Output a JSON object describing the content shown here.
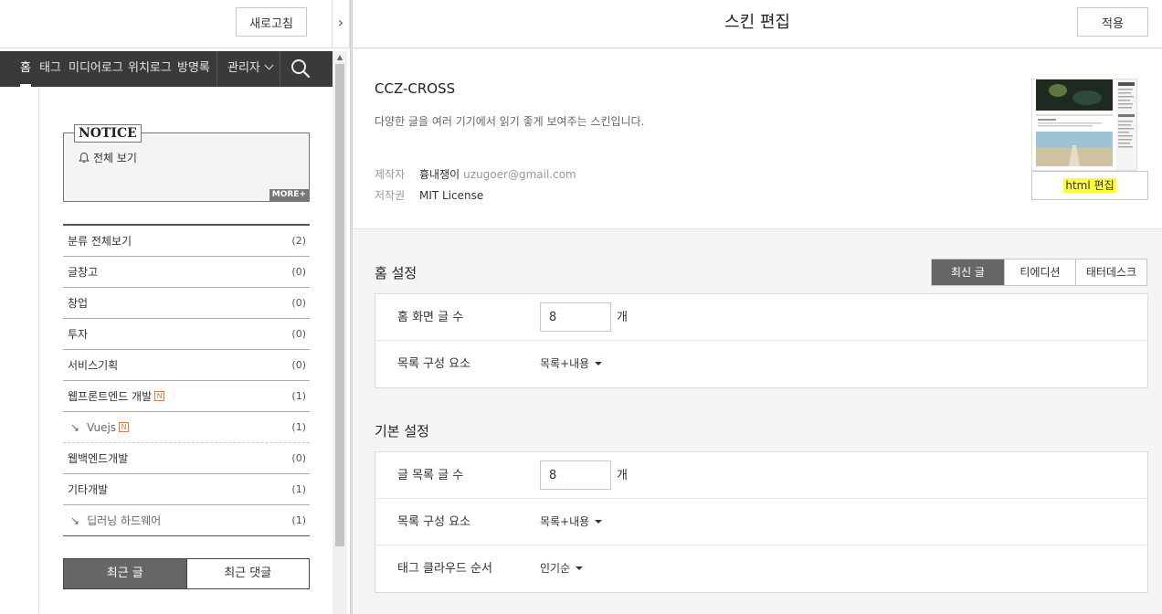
{
  "left": {
    "refresh_label": "새로고침",
    "collapse_glyph": "›",
    "nav": {
      "home": "홈",
      "tag": "태그",
      "media": "미디어로그",
      "location": "위치로그",
      "guestbook": "방명록",
      "admin": "관리자"
    },
    "notice": {
      "title": "NOTICE",
      "view_all": "전체 보기",
      "more": "MORE+"
    },
    "categories": [
      {
        "label": "분류 전체보기",
        "count": "(2)",
        "new": false,
        "sub": false
      },
      {
        "label": "글창고",
        "count": "(0)",
        "new": false,
        "sub": false
      },
      {
        "label": "창업",
        "count": "(0)",
        "new": false,
        "sub": false
      },
      {
        "label": "투자",
        "count": "(0)",
        "new": false,
        "sub": false
      },
      {
        "label": "서비스기획",
        "count": "(0)",
        "new": false,
        "sub": false
      },
      {
        "label": "웹프론트엔드 개발",
        "count": "(1)",
        "new": true,
        "sub": false
      },
      {
        "label": "Vuejs",
        "count": "(1)",
        "new": true,
        "sub": true
      },
      {
        "label": "웹백엔드개발",
        "count": "(0)",
        "new": false,
        "sub": false
      },
      {
        "label": "기타개발",
        "count": "(1)",
        "new": false,
        "sub": false
      },
      {
        "label": "딥러닝 하드웨어",
        "count": "(1)",
        "new": false,
        "sub": true
      }
    ],
    "new_badge": "N",
    "sub_arrow": "↘",
    "recent_tabs": {
      "posts": "최근 글",
      "comments": "최근 댓글"
    }
  },
  "right": {
    "title": "스킨 편집",
    "apply_label": "적용",
    "skin": {
      "name": "CCZ-CROSS",
      "description": "다양한 글을 여러 기기에서 읽기 좋게 보여주는 스킨입니다.",
      "author_label": "제작자",
      "author_name": "흉내쟁이",
      "author_email": "uzugoer@gmail.com",
      "license_label": "저작권",
      "license": "MIT License",
      "html_edit_label": "html 편집"
    },
    "home_settings": {
      "title": "홈 설정",
      "modes": [
        "최신 글",
        "티에디션",
        "태터데스크"
      ],
      "rows": {
        "post_count_label": "홈 화면 글 수",
        "post_count_value": "8",
        "unit": "개",
        "list_elements_label": "목록 구성 요소",
        "list_elements_value": "목록+내용"
      }
    },
    "basic_settings": {
      "title": "기본 설정",
      "rows": {
        "post_count_label": "글 목록 글 수",
        "post_count_value": "8",
        "unit": "개",
        "list_elements_label": "목록 구성 요소",
        "list_elements_value": "목록+내용",
        "tag_order_label": "태그 클라우드 순서",
        "tag_order_value": "인기순"
      }
    }
  },
  "colors": {
    "nav_bg": "#3a3a3a",
    "active_tab_bg": "#666666",
    "highlight": "#fffb3a",
    "new_badge": "#e07a4a"
  }
}
